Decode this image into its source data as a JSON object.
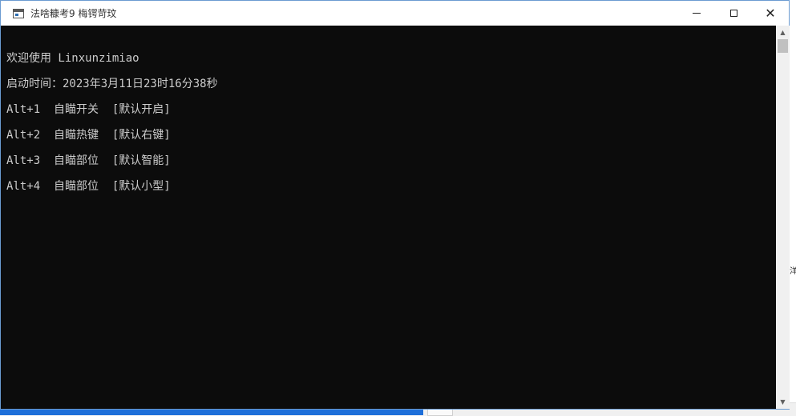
{
  "window": {
    "title": "法啥糠考9 梅锷苛玟",
    "controls": {
      "minimize": "minimize",
      "maximize": "maximize",
      "close": "✕"
    }
  },
  "console": {
    "lines": [
      "欢迎使用 Linxunzimiao",
      "启动时间：2023年3月11日23时16分38秒",
      "Alt+1  自瞄开关  [默认开启]",
      "Alt+2  自瞄热键  [默认右键]",
      "Alt+3  自瞄部位  [默认智能]",
      "Alt+4  自瞄部位  [默认小型]"
    ]
  },
  "scrollbar": {
    "up_icon": "▲",
    "down_icon": "▼"
  },
  "background": {
    "button_icon": "﹀",
    "side_text": "洋"
  },
  "colors": {
    "console_bg": "#0c0c0c",
    "console_text": "#cccccc",
    "titlebar_bg": "#ffffff",
    "desktop_blue": "#1e6fd9"
  }
}
